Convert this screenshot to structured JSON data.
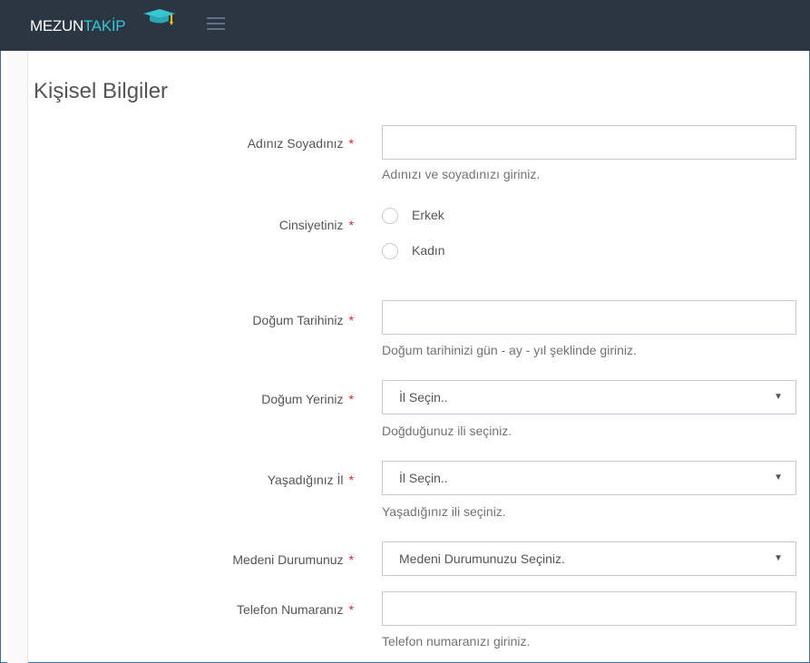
{
  "header": {
    "logo_part1": "MEZUN",
    "logo_part2": "TAKİP",
    "logo_icon": "graduation-cap-icon",
    "menu_icon": "hamburger-menu-icon"
  },
  "colors": {
    "topbar": "#2b3643",
    "accent": "#36c6d3",
    "required": "#e02222",
    "border": "#c2cad8"
  },
  "form": {
    "title": "Kişisel Bilgiler",
    "required_mark": "*",
    "name": {
      "label": "Adınız Soyadınız",
      "value": "",
      "help": "Adınızı ve soyadınızı giriniz."
    },
    "gender": {
      "label": "Cinsiyetiniz",
      "options": [
        "Erkek",
        "Kadın"
      ]
    },
    "birth_date": {
      "label": "Doğum Tarihiniz",
      "value": "",
      "help": "Doğum tarihinizi gün - ay - yıl şeklinde giriniz."
    },
    "birth_place": {
      "label": "Doğum Yeriniz",
      "selected": "İl Seçin..",
      "help": "Doğduğunuz ili seçiniz."
    },
    "city": {
      "label": "Yaşadığınız İl",
      "selected": "İl Seçin..",
      "help": "Yaşadığınız ili seçiniz."
    },
    "marital": {
      "label": "Medeni Durumunuz",
      "selected": "Medeni Durumunuzu Seçiniz."
    },
    "phone": {
      "label": "Telefon Numaranız",
      "value": "",
      "help": "Telefon numaranızı giriniz."
    }
  }
}
